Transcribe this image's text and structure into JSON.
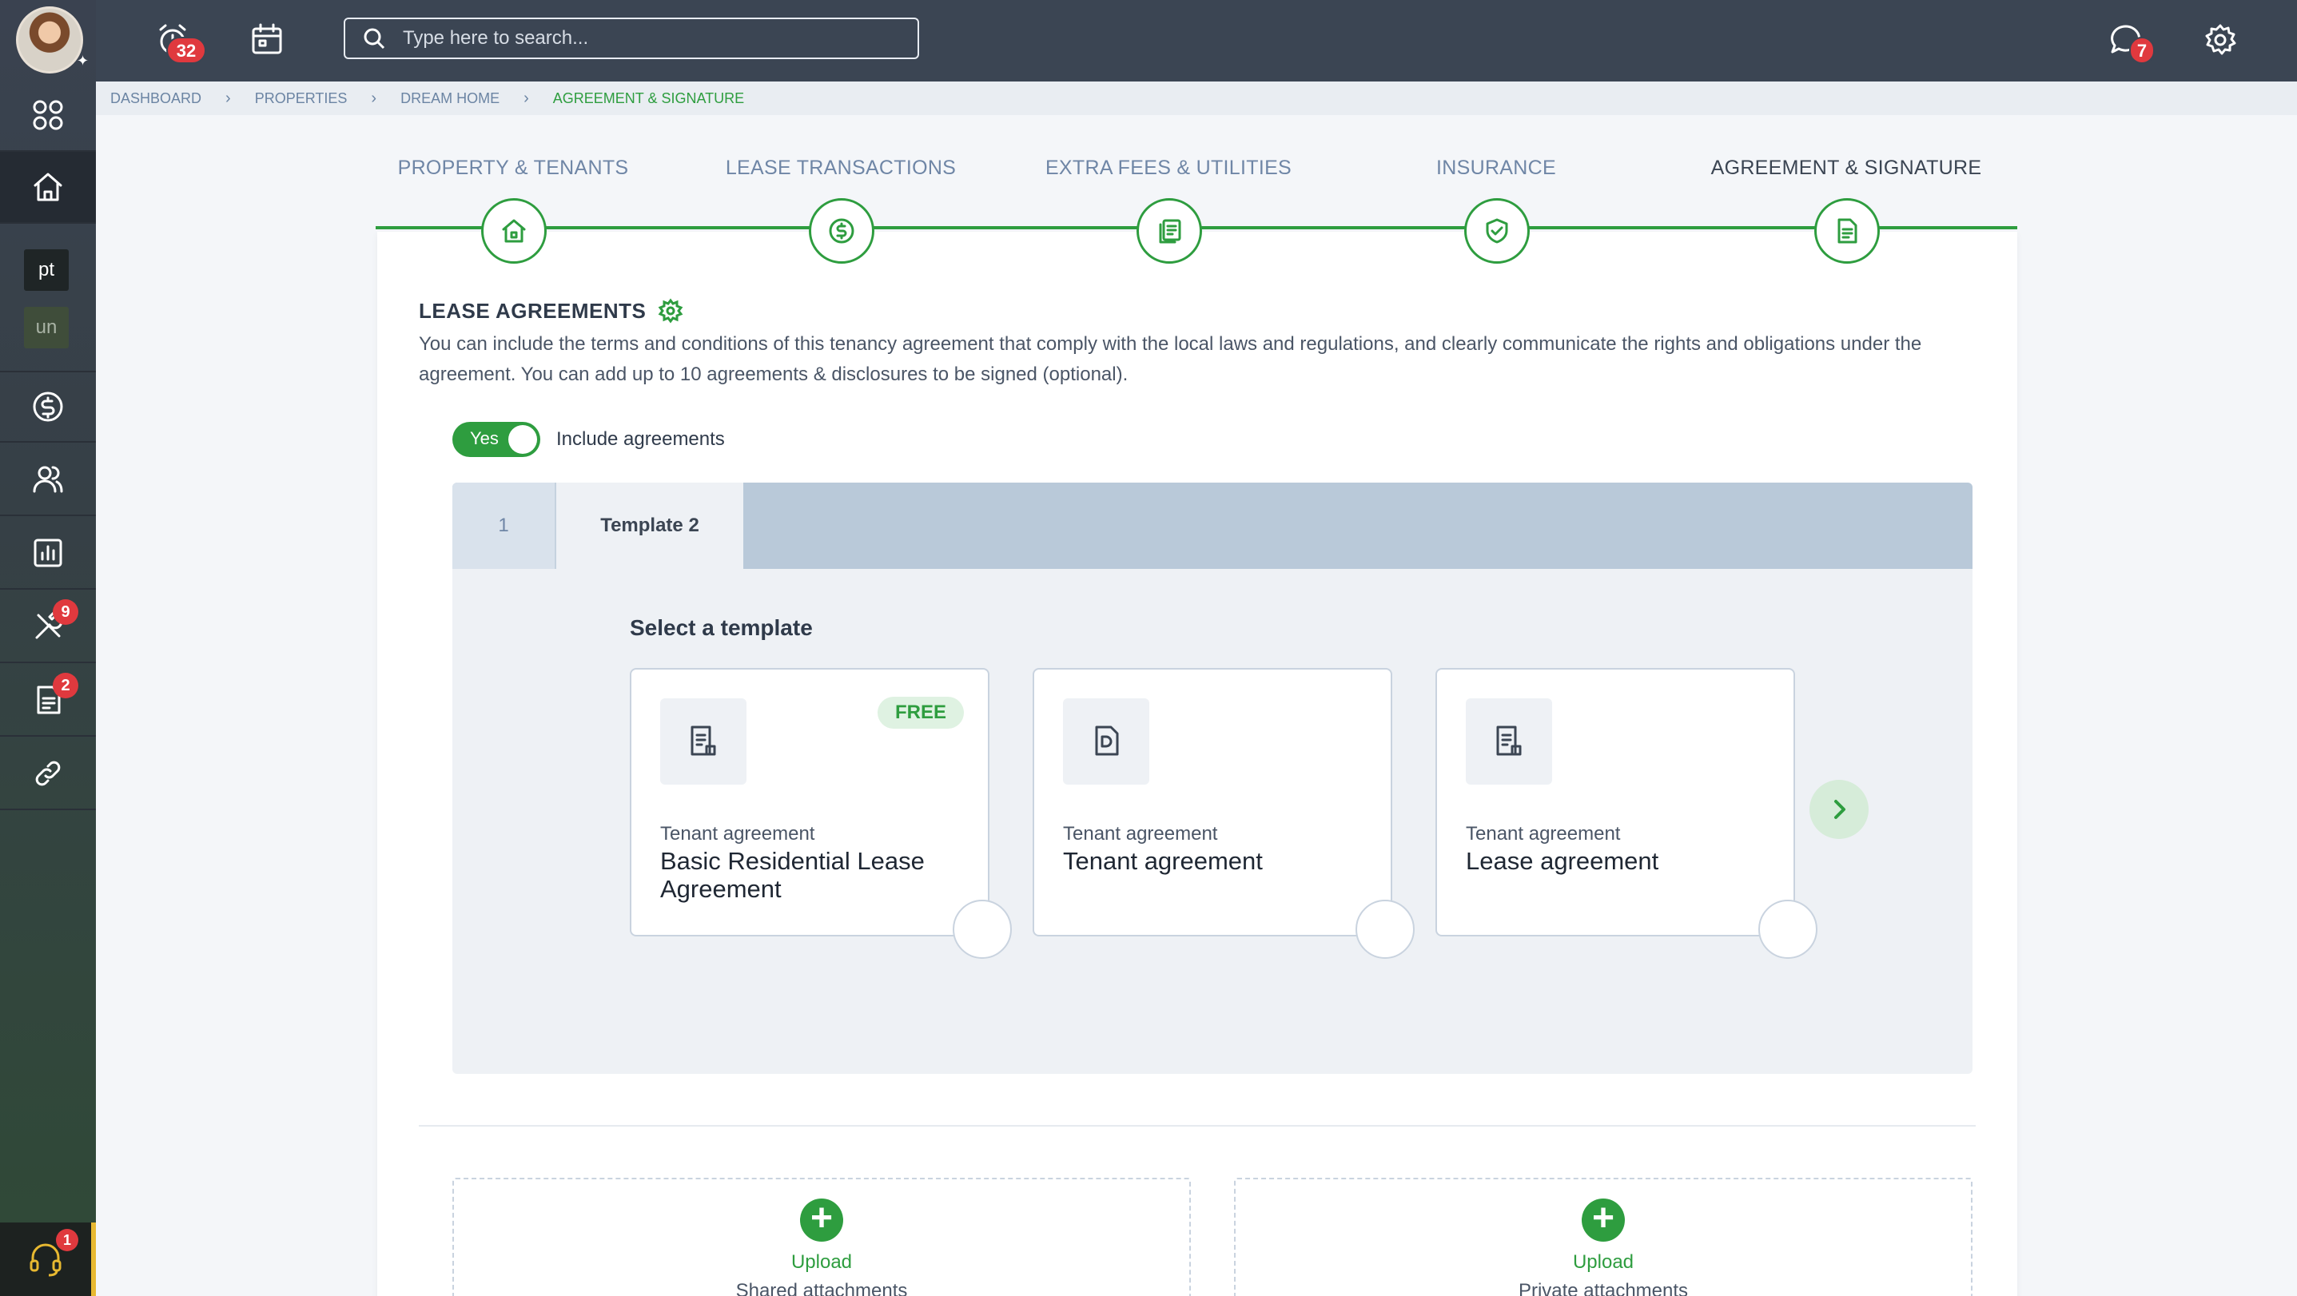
{
  "topbar": {
    "search_placeholder": "Type here to search...",
    "alarm_badge": "32",
    "chat_badge": "7"
  },
  "sidebar": {
    "mini_items": [
      "pt",
      "un"
    ],
    "maintenance_badge": "9",
    "documents_badge": "2",
    "support_badge": "1"
  },
  "breadcrumb": [
    "DASHBOARD",
    "PROPERTIES",
    "DREAM HOME",
    "AGREEMENT & SIGNATURE"
  ],
  "steps": [
    {
      "label": "PROPERTY & TENANTS",
      "icon": "home-icon"
    },
    {
      "label": "LEASE TRANSACTIONS",
      "icon": "dollar-icon"
    },
    {
      "label": "EXTRA FEES & UTILITIES",
      "icon": "bills-icon"
    },
    {
      "label": "INSURANCE",
      "icon": "shield-icon"
    },
    {
      "label": "AGREEMENT & SIGNATURE",
      "icon": "document-icon"
    }
  ],
  "section": {
    "title": "LEASE AGREEMENTS",
    "description": "You can include the terms and conditions of this tenancy agreement that comply with the local laws and regulations, and clearly communicate the rights and obligations under the agreement. You can add up to 10 agreements & disclosures to be signed (optional).",
    "toggle_value": "Yes",
    "toggle_label": "Include agreements"
  },
  "tabs": [
    "1",
    "Template 2"
  ],
  "templates": {
    "heading": "Select a template",
    "items": [
      {
        "category": "Tenant agreement",
        "name": "Basic Residential Lease Agreement",
        "badge": "FREE"
      },
      {
        "category": "Tenant agreement",
        "name": "Tenant agreement",
        "badge": ""
      },
      {
        "category": "Tenant agreement",
        "name": "Lease agreement",
        "badge": ""
      }
    ]
  },
  "uploads": [
    {
      "label": "Upload",
      "sub": "Shared attachments"
    },
    {
      "label": "Upload",
      "sub": "Private attachments"
    }
  ],
  "colors": {
    "accent": "#2e9d3f",
    "topbar": "#3b4553",
    "badge": "#e0393e"
  }
}
